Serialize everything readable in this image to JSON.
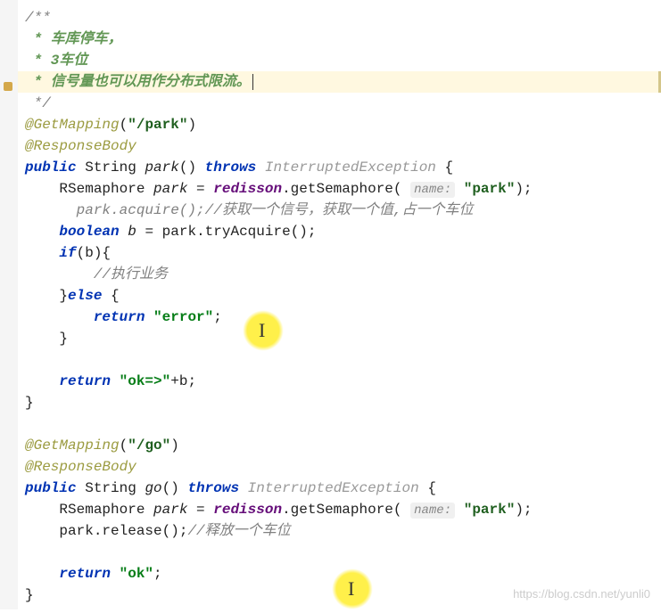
{
  "comment": {
    "open": "/**",
    "l1": " * 车库停车，",
    "l2": " * 3车位",
    "l3": " * 信号量也可以用作分布式限流。",
    "close": " */"
  },
  "ann": {
    "getMapping": "@GetMapping",
    "responseBody": "@ResponseBody"
  },
  "str": {
    "park": "\"/park\"",
    "go": "\"/go\"",
    "parkName": "\"park\"",
    "error": "\"error\"",
    "okArrow": "\"ok=>\"",
    "ok": "\"ok\""
  },
  "kw": {
    "public": "public",
    "throws": "throws",
    "boolean": "boolean",
    "if": "if",
    "else": "else",
    "return": "return"
  },
  "type": {
    "string": "String",
    "rsema": "RSemaphore",
    "exc": "InterruptedException"
  },
  "ident": {
    "parkFn": "park",
    "goFn": "go",
    "parkVar": "park",
    "b": "b",
    "redisson": "redisson"
  },
  "method": {
    "getSemaphore": "getSemaphore",
    "acquire": "acquire",
    "tryAcquire": "tryAcquire",
    "release": "release"
  },
  "hint": {
    "name": "name:"
  },
  "cmt": {
    "acquire": "//获取一个信号，获取一个值,占一个车位",
    "biz": "//执行业务",
    "release": "//释放一个车位"
  },
  "watermark": "https://blog.csdn.net/yunli0"
}
